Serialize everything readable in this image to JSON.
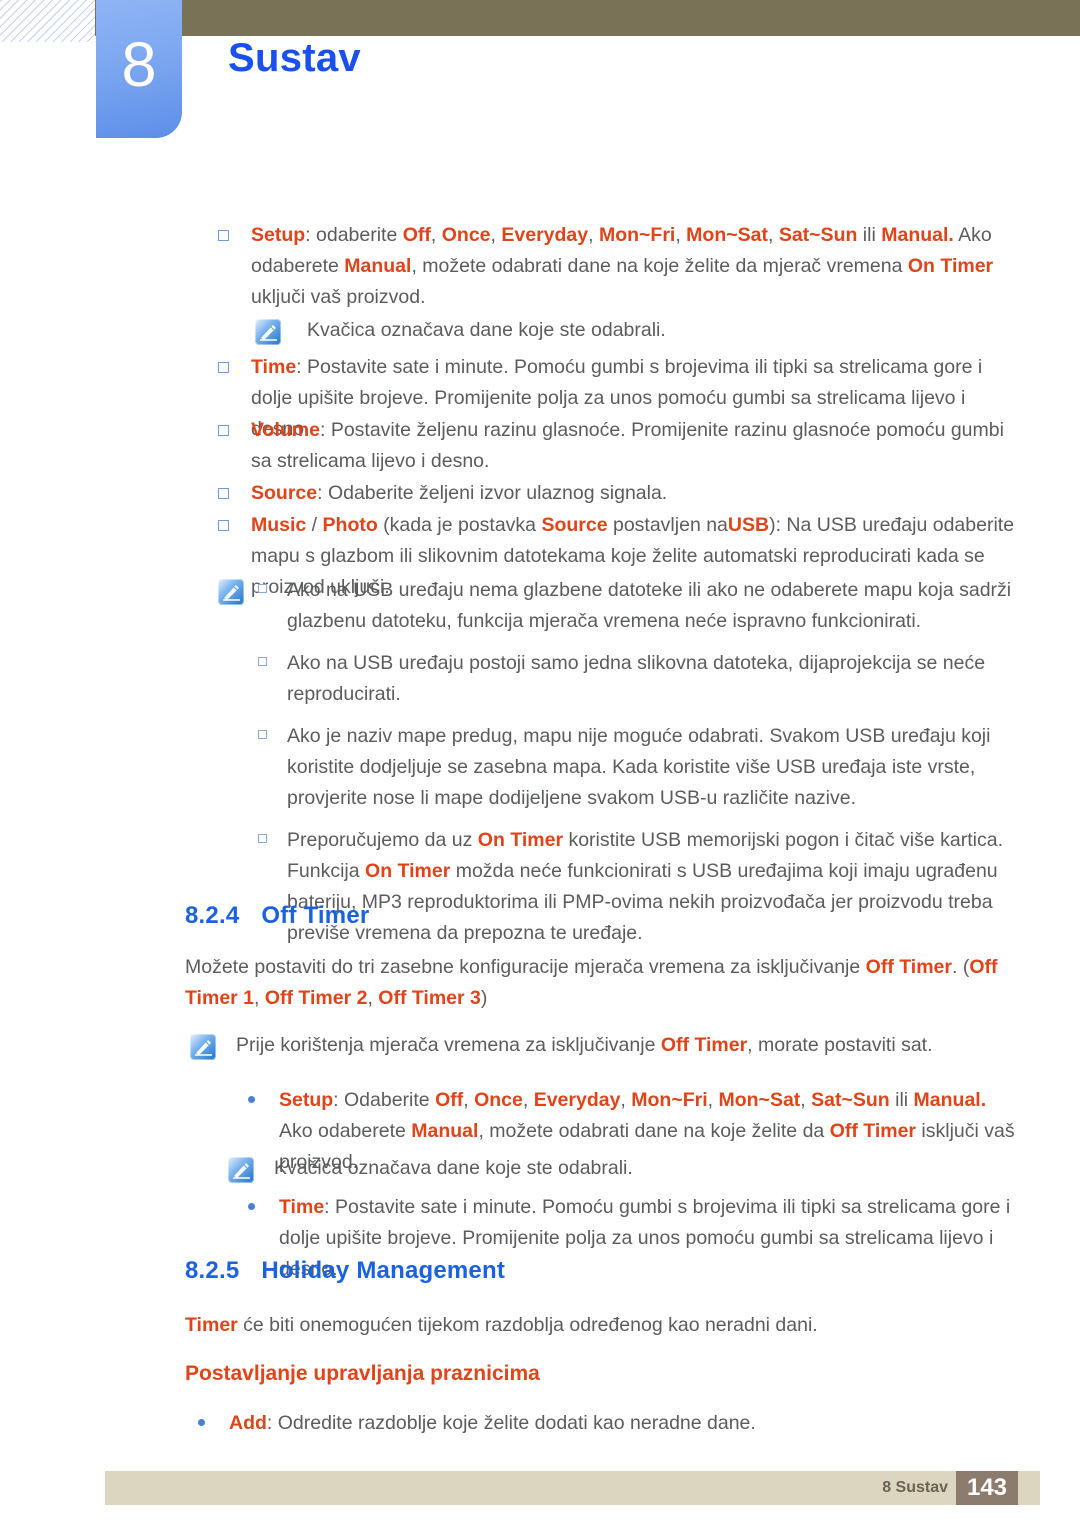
{
  "header": {
    "chapter_number": "8",
    "chapter_title": "Sustav",
    "bar_color": "#7a7256",
    "badge_color": "#7ca7f0",
    "title_color": "#1a4ff0"
  },
  "colors": {
    "emphasis": "#e0451a",
    "heading": "#1a62e0",
    "body": "#5b5c5e",
    "footer_bar": "#dcd6c1",
    "footer_page_box": "#8c7c6e"
  },
  "icons": {
    "note": "note-pencil-icon",
    "bullet_square": "square-bullet-icon",
    "bullet_dot": "dot-bullet-icon"
  },
  "on_timer_section": {
    "setup_bullet": {
      "term": "Setup",
      "text_1": ": odaberite ",
      "options": [
        "Off",
        "Once",
        "Everyday",
        "Mon~Fri",
        "Mon~Sat",
        "Sat~Sun"
      ],
      "text_conj": " ili ",
      "option_manual": "Manual.",
      "text_2": " Ako odaberete ",
      "term_manual_2": "Manual",
      "text_3": ", možete odabrati dane na koje želite da mjerač vremena ",
      "term_on_timer": "On Timer",
      "text_4": " uključi vaš proizvod."
    },
    "note_checkmark": "Kvačica označava dane koje ste odabrali.",
    "time_bullet": {
      "term": "Time",
      "text": ": Postavite  sate  i  minute. Pomoću gumbi s brojevima ili tipki sa strelicama gore i dolje upišite brojeve. Promijenite polja za unos pomoću gumbi sa strelicama lijevo i desno."
    },
    "volume_bullet": {
      "term": "Volume",
      "text": ": Postavite željenu razinu glasnoće. Promijenite razinu glasnoće pomoću gumbi sa strelicama lijevo i desno."
    },
    "source_bullet": {
      "term": "Source",
      "text": ": Odaberite željeni izvor ulaznog signala."
    },
    "music_photo_bullet": {
      "term_music": "Music",
      "separator": " / ",
      "term_photo": "Photo",
      "text_1": " (kada je postavka ",
      "term_source": "Source",
      "text_2": " postavljen na",
      "term_usb": "USB",
      "text_3": "): Na USB uređaju odaberite mapu s glazbom ili slikovnim datotekama koje želite automatski reproducirati kada se proizvod uključi."
    },
    "usb_notes": [
      "Ako na USB uređaju nema glazbene datoteke ili ako ne odaberete mapu koja sadrži glazbenu datoteku, funkcija mjerača vremena neće ispravno funkcionirati.",
      "Ako na USB uređaju postoji samo jedna slikovna datoteka, dijaprojekcija se neće reproducirati.",
      "Ako je naziv mape predug, mapu nije moguće odabrati. Svakom USB uređaju koji koristite dodjeljuje se zasebna mapa. Kada koristite više USB uređaja iste vrste, provjerite nose li mape dodijeljene svakom USB-u različite nazive."
    ],
    "usb_note_on_timer": {
      "text_1": "Preporučujemo da uz ",
      "term_1": "On Timer",
      "text_2": " koristite USB memorijski pogon i čitač više kartica. Funkcija ",
      "term_2": "On Timer",
      "text_3": " možda neće funkcionirati s USB uređajima koji imaju ugrađenu bateriju, MP3 reproduktorima ili PMP-ovima nekih proizvođača jer proizvodu treba previše vremena da prepozna te uređaje."
    }
  },
  "off_timer_section": {
    "number": "8.2.4",
    "title": "Off Timer",
    "intro": {
      "text_1": "Možete postaviti do tri zasebne konfiguracije mjerača vremena za isključivanje ",
      "term_1": "Off Timer",
      "text_2": ". (",
      "term_2": "Off Timer 1",
      "text_3": ", ",
      "term_3": "Off Timer 2",
      "text_4": ", ",
      "term_4": "Off Timer 3",
      "text_5": ")"
    },
    "note_prereq": {
      "text_1": "Prije korištenja mjerača vremena za isključivanje ",
      "term_1": "Off Timer",
      "text_2": ", morate postaviti sat."
    },
    "setup_bullet": {
      "term": "Setup",
      "text_1": ": Odaberite ",
      "options": [
        "Off",
        "Once",
        "Everyday",
        "Mon~Fri",
        "Mon~Sat",
        "Sat~Sun"
      ],
      "text_conj": " ili ",
      "option_manual": "Manual.",
      "text_2": " Ako odaberete ",
      "term_manual_2": "Manual",
      "text_3": ", možete odabrati dane na koje želite da ",
      "term_off_timer": "Off Timer",
      "text_4": " isključi vaš proizvod."
    },
    "note_checkmark": "Kvačica označava dane koje ste odabrali.",
    "time_bullet": {
      "term": "Time",
      "text": ": Postavite  sate  i  minute. Pomoću gumbi s brojevima ili tipki sa strelicama gore i dolje upišite brojeve. Promijenite polja za unos pomoću gumbi sa strelicama lijevo i desno."
    }
  },
  "holiday_section": {
    "number": "8.2.5",
    "title": "Holiday Management",
    "intro": {
      "term": "Timer",
      "text": " će biti onemogućen tijekom razdoblja određenog kao neradni dani."
    },
    "subheading": "Postavljanje upravljanja praznicima",
    "add_bullet": {
      "term": "Add",
      "text": ": Odredite razdoblje koje želite dodati kao neradne dane."
    }
  },
  "footer": {
    "label": "8 Sustav",
    "page": "143"
  }
}
